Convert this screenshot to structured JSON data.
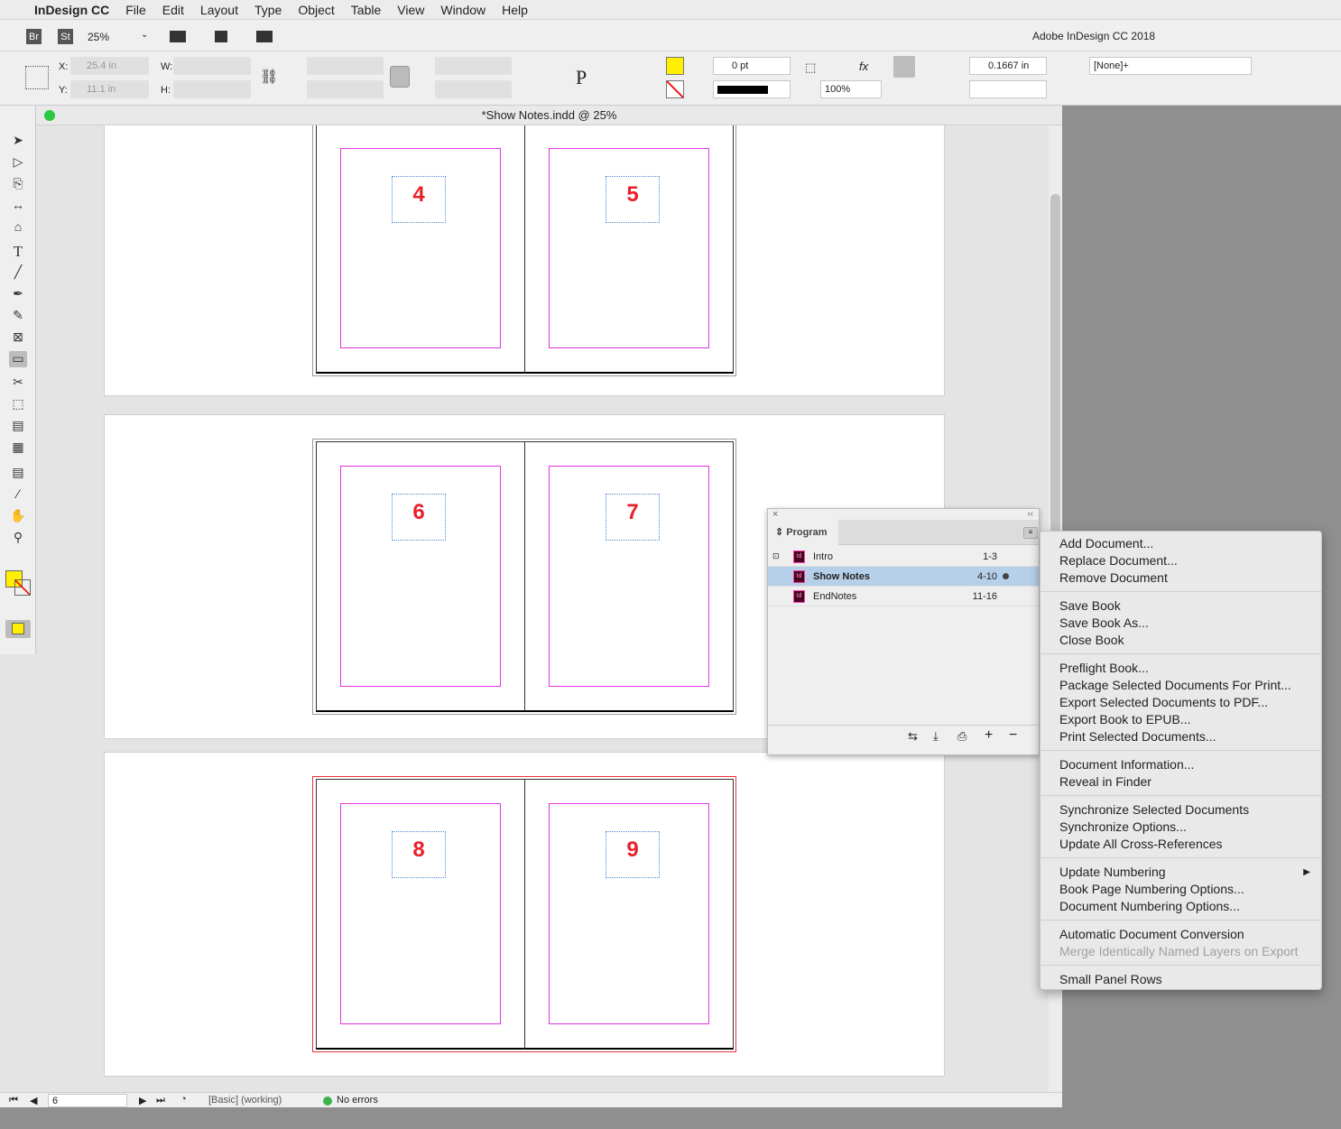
{
  "menubar": {
    "app": "InDesign CC",
    "items": [
      "File",
      "Edit",
      "Layout",
      "Type",
      "Object",
      "Table",
      "View",
      "Window",
      "Help"
    ]
  },
  "appbar": {
    "bridge": "Br",
    "stock": "St",
    "zoom": "25%",
    "title": "Adobe InDesign CC 2018"
  },
  "control": {
    "x_label": "X:",
    "x_value": "25.4 in",
    "y_label": "Y:",
    "y_value": "11.1 in",
    "w_label": "W:",
    "h_label": "H:",
    "stroke_weight": "0 pt",
    "opacity": "100%",
    "offset": "0.1667 in",
    "object_style": "[None]+",
    "fill_color": "#ffef00"
  },
  "document": {
    "title": "*Show Notes.indd @ 25%",
    "page_numbers": [
      [
        "4",
        "5"
      ],
      [
        "6",
        "7"
      ],
      [
        "8",
        "9"
      ]
    ]
  },
  "status": {
    "page": "6",
    "preflight_profile": "[Basic] (working)",
    "errors": "No errors"
  },
  "book_panel": {
    "tab": "Program",
    "rows": [
      {
        "name": "Intro",
        "pages": "1-3",
        "selected": false
      },
      {
        "name": "Show Notes",
        "pages": "4-10",
        "selected": true,
        "open": true
      },
      {
        "name": "EndNotes",
        "pages": "11-16",
        "selected": false
      }
    ]
  },
  "menu": {
    "groups": [
      [
        {
          "label": "Add Document..."
        },
        {
          "label": "Replace Document..."
        },
        {
          "label": "Remove Document"
        }
      ],
      [
        {
          "label": "Save Book"
        },
        {
          "label": "Save Book As..."
        },
        {
          "label": "Close Book"
        }
      ],
      [
        {
          "label": "Preflight Book..."
        },
        {
          "label": "Package Selected Documents For Print..."
        },
        {
          "label": "Export Selected Documents to PDF..."
        },
        {
          "label": "Export Book to EPUB..."
        },
        {
          "label": "Print Selected Documents..."
        }
      ],
      [
        {
          "label": "Document Information..."
        },
        {
          "label": "Reveal in Finder"
        }
      ],
      [
        {
          "label": "Synchronize Selected Documents"
        },
        {
          "label": "Synchronize Options..."
        },
        {
          "label": "Update All Cross-References"
        }
      ],
      [
        {
          "label": "Update Numbering",
          "submenu": true
        },
        {
          "label": "Book Page Numbering Options..."
        },
        {
          "label": "Document Numbering Options..."
        }
      ],
      [
        {
          "label": "Automatic Document Conversion"
        },
        {
          "label": "Merge Identically Named Layers on Export",
          "disabled": true
        }
      ],
      [
        {
          "label": "Small Panel Rows"
        }
      ]
    ]
  }
}
